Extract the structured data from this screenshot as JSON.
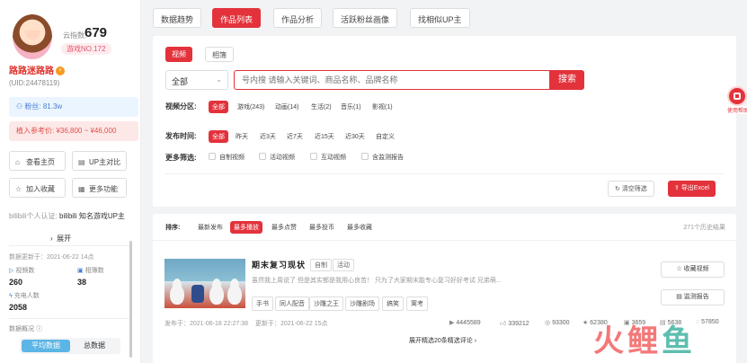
{
  "profile": {
    "fans_label": "云指数:",
    "fans_value": "679",
    "rank": "游戏NO.172",
    "name": "路路迷路路",
    "level_badge": "",
    "uid": "(UID:24478119)",
    "fans_count": "粉丝: 81.3w",
    "price": "植入参考价: ¥36,800 ~ ¥46,000"
  },
  "sidebar_buttons": {
    "home": "查看主页",
    "compare": "UP主对比",
    "favorite": "加入收藏",
    "more": "更多功能"
  },
  "cert": {
    "label": "bilibili个人认证:",
    "text": "bilibili 知名游戏UP主",
    "expand": "展开"
  },
  "stats": {
    "updated": "数据更新于：2021-06-22 14点",
    "video_count_label": "视频数",
    "video_count": "260",
    "album_count_label": "相簿数",
    "album_count": "38",
    "charge_label": "充电人数",
    "charge_count": "2058",
    "overview_label": "数据概况"
  },
  "data_toggle": {
    "avg": "平均数据",
    "total": "总数据"
  },
  "tabs": [
    {
      "label": "数据趋势"
    },
    {
      "label": "作品列表"
    },
    {
      "label": "作品分析"
    },
    {
      "label": "活跃粉丝画像"
    },
    {
      "label": "找相似UP主"
    }
  ],
  "content_type": {
    "video": "视频",
    "album": "相簿"
  },
  "search": {
    "scope": "全部",
    "placeholder": "号内搜 请输入关键词、商品名称、品牌名称",
    "button": "搜索"
  },
  "filters": {
    "partition_label": "视频分区:",
    "partitions": [
      "全部",
      "游戏(243)",
      "动画(14)",
      "生活(2)",
      "音乐(1)",
      "影视(1)"
    ],
    "time_label": "发布时间:",
    "times": [
      "全部",
      "昨天",
      "近3天",
      "近7天",
      "近15天",
      "近30天",
      "自定义"
    ],
    "more_label": "更多筛选:",
    "more": [
      "自制视频",
      "活动视频",
      "互动视频",
      "含监测报告"
    ],
    "clear": "清空筛选",
    "export": "导出Excel"
  },
  "sort": {
    "label": "排序:",
    "options": [
      "最新发布",
      "最多播放",
      "最多点赞",
      "最多投币",
      "最多收藏"
    ],
    "history": "271个历史结果"
  },
  "video": {
    "title": "期末复习现状",
    "tags": [
      "自制",
      "活动"
    ],
    "desc": "虽然我上周说了 但是其实都是我用心良苦！ 只为了大家期末能专心复习好好考试 兄弟萌...",
    "keywords": [
      "手书",
      "同人配音",
      "沙雕之王",
      "沙雕剧场",
      "搞笑",
      "寓考"
    ],
    "favorite": "收藏视频",
    "report": "监测报告",
    "published": "发布于：2021-06-18 22:27:38",
    "updated": "更新于：2021-06-22 15点",
    "plays": "4445589",
    "likes": "339212",
    "coins": "93300",
    "favorites": "62380",
    "shares": "3659",
    "danmaku": "5638",
    "comments": "57850",
    "more_comments": "展开精选20条精选评论"
  },
  "float": {
    "label": "使用帮助"
  },
  "watermark": {
    "w1": "火",
    "w2": "鲤",
    "w3": "鱼"
  }
}
